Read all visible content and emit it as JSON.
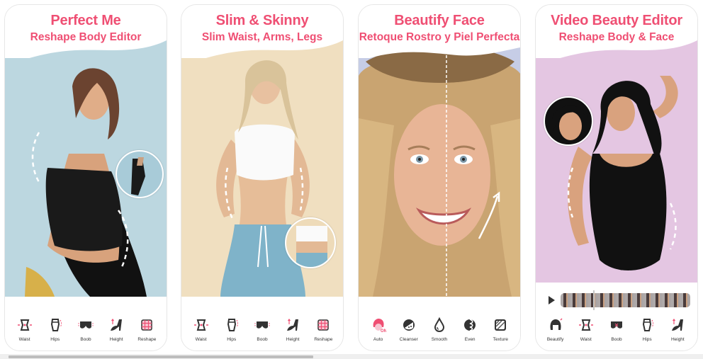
{
  "colors": {
    "accent": "#ef4f73",
    "card1_bg": "#bcd7e0",
    "card2_bg": "#f0dfc0",
    "card3_bg": "#c6cde6",
    "card4_bg": "#e4c6e2"
  },
  "cards": [
    {
      "title": "Perfect Me",
      "subtitle": "Reshape Body Editor",
      "image": "woman-black-swimsuit-back-view",
      "tools": [
        {
          "label": "Waist",
          "icon": "waist-icon"
        },
        {
          "label": "Hips",
          "icon": "hips-icon"
        },
        {
          "label": "Boob",
          "icon": "boob-icon"
        },
        {
          "label": "Height",
          "icon": "height-heel-icon"
        },
        {
          "label": "Reshape",
          "icon": "reshape-grid-icon"
        }
      ]
    },
    {
      "title": "Slim & Skinny",
      "subtitle": "Slim Waist, Arms, Legs",
      "image": "woman-crop-top-jeans",
      "tools": [
        {
          "label": "Waist",
          "icon": "waist-icon"
        },
        {
          "label": "Hips",
          "icon": "hips-icon"
        },
        {
          "label": "Boob",
          "icon": "boob-icon"
        },
        {
          "label": "Height",
          "icon": "height-heel-icon"
        },
        {
          "label": "Reshape",
          "icon": "reshape-grid-icon"
        }
      ]
    },
    {
      "title": "Beautify Face",
      "subtitle": "Retoque Rostro y Piel Perfecta",
      "image": "face-before-after-split",
      "tools": [
        {
          "label": "Auto",
          "icon": "auto-beauty-icon"
        },
        {
          "label": "Cleanser",
          "icon": "cleanser-icon"
        },
        {
          "label": "Smooth",
          "icon": "smooth-drop-icon"
        },
        {
          "label": "Even",
          "icon": "even-tone-icon"
        },
        {
          "label": "Texture",
          "icon": "texture-icon"
        }
      ]
    },
    {
      "title": "Video Beauty Editor",
      "subtitle": "Reshape Body & Face",
      "image": "woman-black-bodysuit",
      "tools": [
        {
          "label": "Beautify",
          "icon": "beautify-face-icon"
        },
        {
          "label": "Waist",
          "icon": "waist-icon"
        },
        {
          "label": "Boob",
          "icon": "boob-icon"
        },
        {
          "label": "Hips",
          "icon": "hips-icon"
        },
        {
          "label": "Height",
          "icon": "height-heel-icon"
        }
      ]
    }
  ]
}
